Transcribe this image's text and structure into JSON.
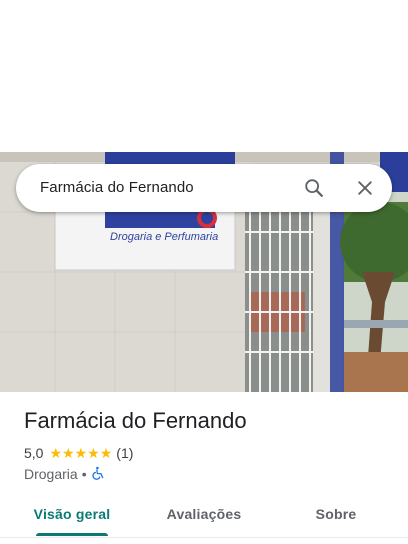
{
  "search": {
    "query": "Farmácia do Fernando",
    "search_icon": "search-icon",
    "close_icon": "close-icon"
  },
  "photo": {
    "sign_text": "Drogaria e Perfumaria"
  },
  "place": {
    "name": "Farmácia do Fernando",
    "rating": "5,0",
    "stars": 5,
    "review_count": "(1)",
    "category": "Drogaria",
    "separator": "•",
    "accessibility_icon": "wheelchair-icon"
  },
  "tabs": [
    {
      "label": "Visão geral",
      "active": true
    },
    {
      "label": "Avaliações",
      "active": false
    },
    {
      "label": "Sobre",
      "active": false
    }
  ],
  "colors": {
    "accent": "#0b7a75",
    "star": "#fbbc04",
    "accessibility": "#1a73e8"
  }
}
